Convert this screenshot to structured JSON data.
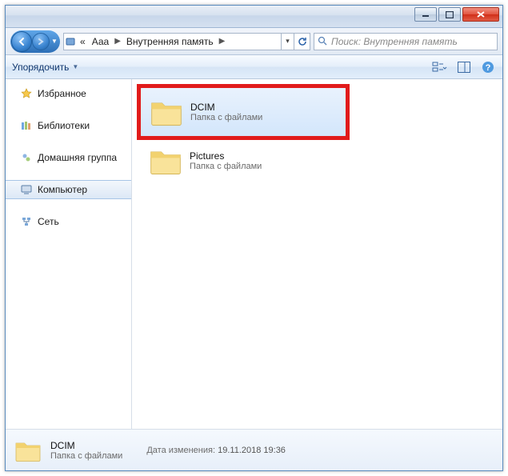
{
  "breadcrumb": {
    "prefix": "«",
    "seg1": "Ааа",
    "seg2": "Внутренняя память"
  },
  "search": {
    "placeholder": "Поиск: Внутренняя память"
  },
  "toolbar": {
    "organize": "Упорядочить"
  },
  "sidebar": {
    "favorites": "Избранное",
    "libraries": "Библиотеки",
    "homegroup": "Домашняя группа",
    "computer": "Компьютер",
    "network": "Сеть"
  },
  "folders": [
    {
      "name": "DCIM",
      "sub": "Папка с файлами",
      "selected": true,
      "highlighted": true
    },
    {
      "name": "Pictures",
      "sub": "Папка с файлами",
      "selected": false,
      "highlighted": false
    }
  ],
  "status": {
    "name": "DCIM",
    "sub": "Папка с файлами",
    "meta_label": "Дата изменения:",
    "meta_value": "19.11.2018 19:36"
  }
}
